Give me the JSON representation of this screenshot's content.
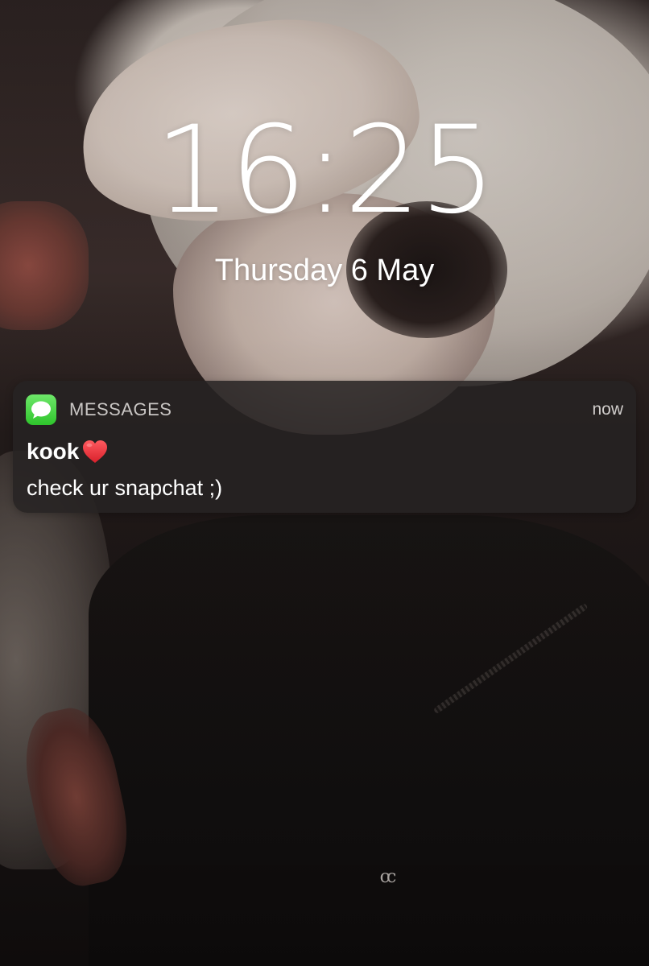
{
  "lockscreen": {
    "time": "16:25",
    "date": "Thursday 6 May"
  },
  "notification": {
    "app_name": "MESSAGES",
    "app_icon": "messages-bubble-icon",
    "timestamp": "now",
    "sender": "kook",
    "sender_emoji": "red-heart-icon",
    "message": "check ur snapchat ;)"
  },
  "wallpaper": {
    "shirt_logo": "cc"
  },
  "colors": {
    "messages_green": "#34c431",
    "heart_red": "#e8323c",
    "notification_bg": "#262323",
    "text_primary": "#ffffff",
    "text_secondary": "#c9c6c4"
  }
}
